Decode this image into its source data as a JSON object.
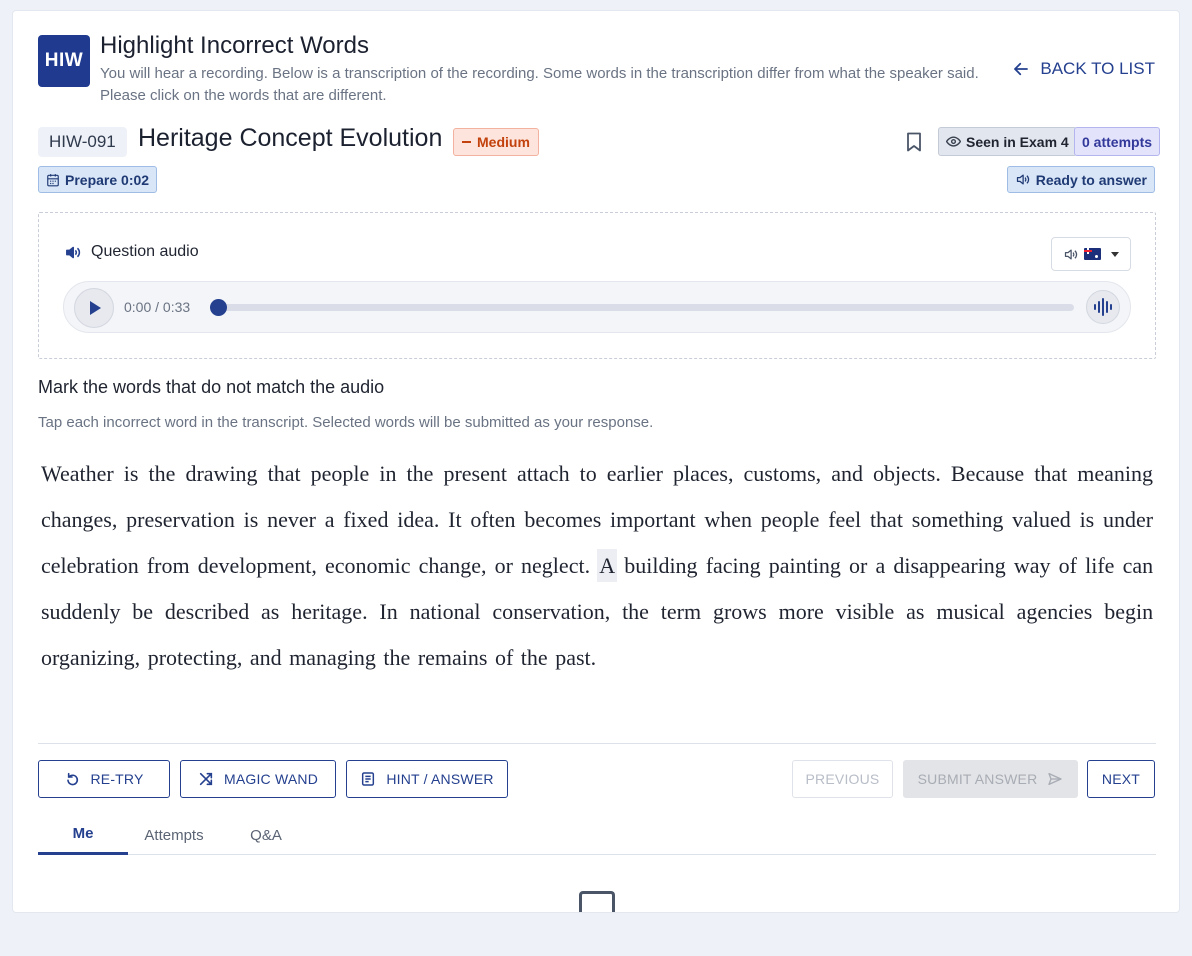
{
  "header": {
    "logo": "HIW",
    "title": "Highlight Incorrect Words",
    "subtitle": "You will hear a recording. Below is a transcription of the recording. Some words in the transcription differ from what the speaker said. Please click on the words that are different.",
    "back_label": "BACK TO LIST"
  },
  "question": {
    "id": "HIW-091",
    "title": "Heritage Concept Evolution",
    "difficulty": "Medium",
    "seen_label": "Seen in Exam 4",
    "attempts_label": "0 attempts",
    "prepare_label": "Prepare 0:02",
    "status_label": "Ready to answer"
  },
  "audio": {
    "label": "Question audio",
    "time": "0:00 / 0:33",
    "progress": 0
  },
  "instructions": {
    "title": "Mark the words that do not match the audio",
    "subtitle": "Tap each incorrect word in the transcript. Selected words will be submitted as your response."
  },
  "transcript": [
    "Weather",
    "is",
    "the",
    "drawing",
    "that",
    "people",
    "in",
    "the",
    "present",
    "attach",
    "to",
    "earlier",
    "places,",
    "customs,",
    "and",
    "objects.",
    "Because",
    "that",
    "meaning",
    "changes,",
    "preservation",
    "is",
    "never",
    "a",
    "fixed",
    "idea.",
    "It",
    "often",
    "becomes",
    "important",
    "when",
    "people",
    "feel",
    "that",
    "something",
    "valued",
    "is",
    "under",
    "celebration",
    "from",
    "development,",
    "economic",
    "change,",
    "or",
    "neglect.",
    "A",
    "building",
    "facing",
    "painting",
    "or",
    "a",
    "disappearing",
    "way",
    "of",
    "life",
    "can",
    "suddenly",
    "be",
    "described",
    "as",
    "heritage.",
    "In",
    "national",
    "conservation,",
    "the",
    "term",
    "grows",
    "more",
    "visible",
    "as",
    "musical",
    "agencies",
    "begin",
    "organizing,",
    "protecting,",
    "and",
    "managing",
    "the",
    "remains",
    "of",
    "the",
    "past."
  ],
  "highlighted_index": 45,
  "actions": {
    "retry": "RE-TRY",
    "magic": "MAGIC WAND",
    "hint": "HINT / ANSWER",
    "previous": "PREVIOUS",
    "submit": "SUBMIT ANSWER",
    "next": "NEXT"
  },
  "tabs": [
    "Me",
    "Attempts",
    "Q&A"
  ],
  "colors": {
    "accent": "#24408f",
    "medium": "#c2410c"
  }
}
